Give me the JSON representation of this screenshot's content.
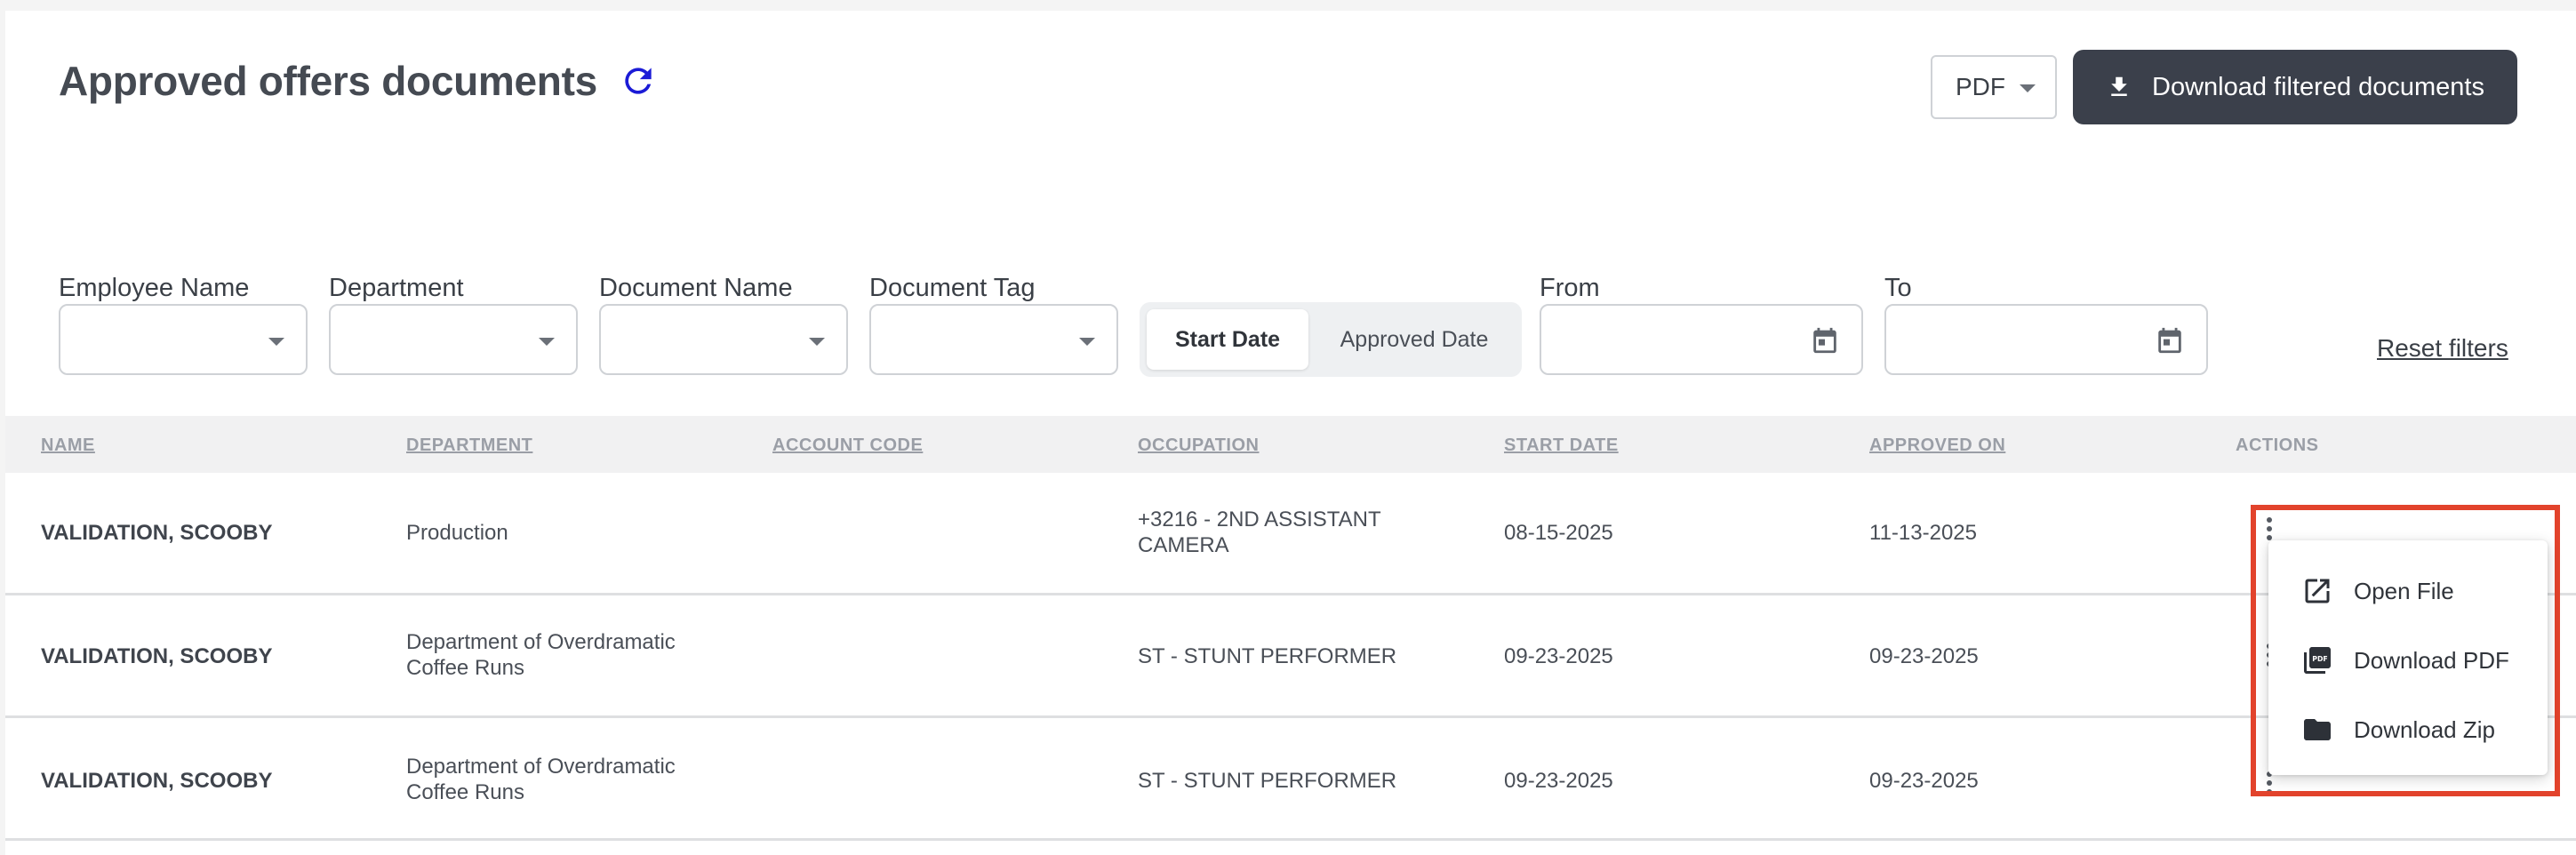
{
  "header": {
    "title": "Approved offers documents",
    "format_select": "PDF",
    "download_button": "Download filtered documents"
  },
  "filters": {
    "employee_name": "Employee Name",
    "department": "Department",
    "document_name": "Document Name",
    "document_tag": "Document Tag",
    "date_toggle": {
      "start_date": "Start Date",
      "approved_date": "Approved Date",
      "active": "Start Date"
    },
    "from": "From",
    "to": "To",
    "reset": "Reset filters"
  },
  "table": {
    "columns": {
      "name": "NAME",
      "department": "DEPARTMENT",
      "account_code": "ACCOUNT CODE",
      "occupation": "OCCUPATION",
      "start_date": "START DATE",
      "approved_on": "APPROVED ON",
      "actions": "ACTIONS"
    },
    "rows": [
      {
        "name": "VALIDATION, SCOOBY",
        "department_line1": "Production",
        "department_line2": "",
        "account_code": "",
        "occupation_line1": "+3216 - 2ND ASSISTANT",
        "occupation_line2": "CAMERA",
        "start_date": "08-15-2025",
        "approved_on": "11-13-2025"
      },
      {
        "name": "VALIDATION, SCOOBY",
        "department_line1": "Department of Overdramatic",
        "department_line2": "Coffee Runs",
        "account_code": "",
        "occupation_line1": "ST - STUNT PERFORMER",
        "occupation_line2": "",
        "start_date": "09-23-2025",
        "approved_on": "09-23-2025"
      },
      {
        "name": "VALIDATION, SCOOBY",
        "department_line1": "Department of Overdramatic",
        "department_line2": "Coffee Runs",
        "account_code": "",
        "occupation_line1": "ST - STUNT PERFORMER",
        "occupation_line2": "",
        "start_date": "09-23-2025",
        "approved_on": "09-23-2025"
      }
    ]
  },
  "actions_menu": {
    "items": [
      {
        "label": "Open File",
        "icon": "open-in-new-icon"
      },
      {
        "label": "Download PDF",
        "icon": "pdf-icon"
      },
      {
        "label": "Download Zip",
        "icon": "folder-icon"
      }
    ]
  },
  "colors": {
    "primary_button": "#3b404b",
    "refresh_icon": "#1b1bd6",
    "highlight": "#e2432c"
  }
}
